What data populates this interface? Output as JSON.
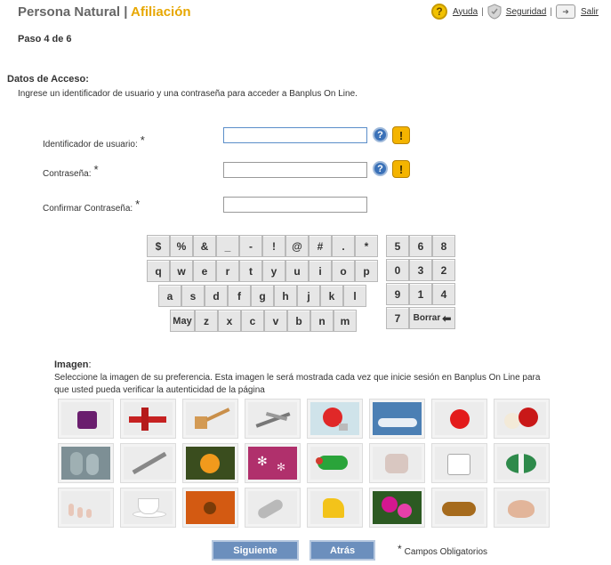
{
  "header": {
    "title_main": "Persona Natural",
    "separator": "|",
    "title_accent": "Afiliación",
    "help_label": "Ayuda",
    "security_label": "Seguridad",
    "exit_label": "Salir",
    "accent_color": "#e7a700"
  },
  "step": "Paso 4 de 6",
  "access": {
    "title": "Datos de Acceso:",
    "description": "Ingrese un identificador de usuario y una contraseña para acceder a Banplus On Line."
  },
  "fields": {
    "username_label": "Identificador de usuario:",
    "password_label": "Contraseña:",
    "confirm_label": "Confirmar Contraseña:",
    "required_mark": "*",
    "username_value": "",
    "password_value": "",
    "confirm_value": ""
  },
  "keyboard": {
    "row1": [
      "$",
      "%",
      "&",
      "_",
      "-",
      "!",
      "@",
      "#",
      ".",
      "*"
    ],
    "row2": [
      "q",
      "w",
      "e",
      "r",
      "t",
      "y",
      "u",
      "i",
      "o",
      "p"
    ],
    "row3": [
      "a",
      "s",
      "d",
      "f",
      "g",
      "h",
      "j",
      "k",
      "l"
    ],
    "row4": [
      "May",
      "z",
      "x",
      "c",
      "v",
      "b",
      "n",
      "m"
    ],
    "numpad": [
      "5",
      "6",
      "8",
      "0",
      "3",
      "2",
      "9",
      "1",
      "4",
      "7"
    ],
    "backspace_label": "Borrar"
  },
  "image_selection": {
    "title": "Imagen",
    "colon": ":",
    "description": "Seleccione la imagen de su preferencia. Esta imagen le será mostrada cada vez que inicie sesión en Banplus On Line para que usted pueda verificar la autenticidad de la página",
    "images": [
      "purple-candle",
      "red-airplane",
      "wooden-mallet",
      "pliers",
      "red-lightbulb",
      "blue-sky-branches",
      "red-apple",
      "red-white-roses",
      "cactus",
      "lighter",
      "orange-fruit",
      "pink-snowflakes",
      "green-parrot",
      "flower-pot",
      "coffee-mug",
      "green-rugby-ball",
      "chess-pieces",
      "tea-cup",
      "orange-flower",
      "metal-scoop",
      "yellow-dinosaur",
      "pink-bougainvillea",
      "golden-ornament",
      "seashell"
    ]
  },
  "buttons": {
    "next": "Siguiente",
    "back": "Atrás"
  },
  "required_note": "Campos Obligatorios"
}
